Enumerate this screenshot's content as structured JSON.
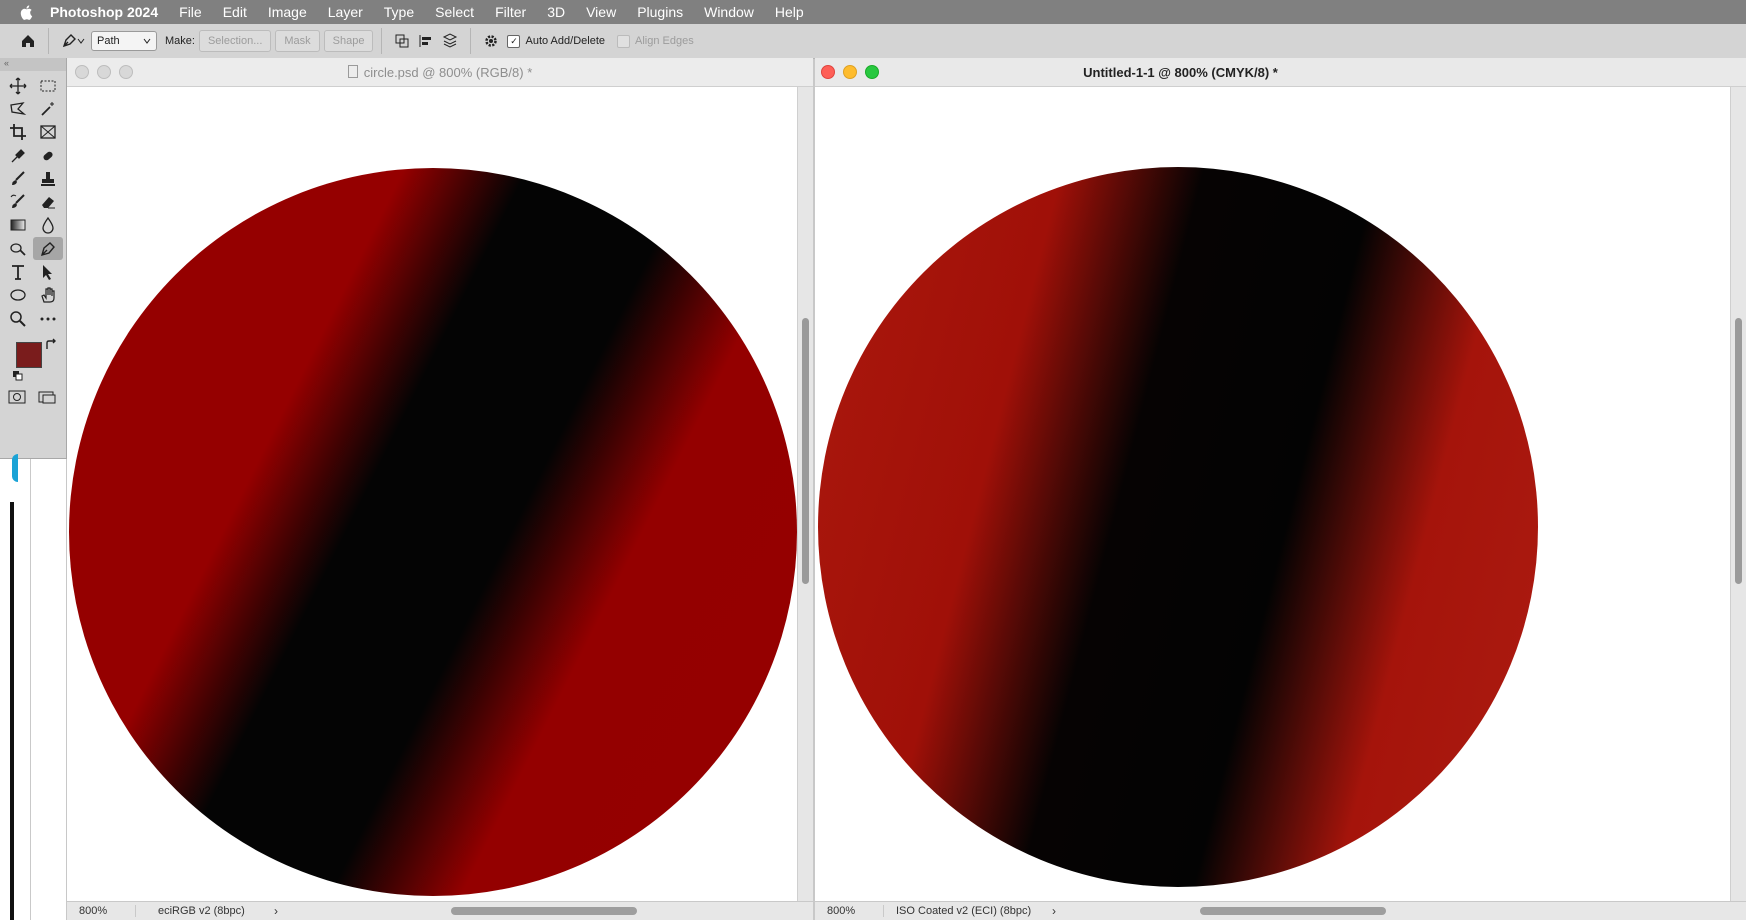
{
  "menubar": {
    "app_name": "Photoshop 2024",
    "items": [
      "File",
      "Edit",
      "Image",
      "Layer",
      "Type",
      "Select",
      "Filter",
      "3D",
      "View",
      "Plugins",
      "Window",
      "Help"
    ]
  },
  "options_bar": {
    "mode_value": "Path",
    "make_label": "Make:",
    "selection_button": "Selection...",
    "mask_button": "Mask",
    "shape_button": "Shape",
    "auto_add_delete": "Auto Add/Delete",
    "auto_add_delete_checked": true,
    "align_edges": "Align Edges",
    "align_edges_checked": false
  },
  "toolbox": {
    "grip": "≡≡≡≡≡",
    "tools": [
      "move-icon",
      "marquee-rect-icon",
      "lasso-polygon-icon",
      "magic-wand-icon",
      "crop-icon",
      "frame-icon",
      "eyedropper-icon",
      "healing-brush-icon",
      "brush-icon",
      "clone-stamp-icon",
      "history-brush-icon",
      "eraser-icon",
      "gradient-icon",
      "blur-icon",
      "dodge-icon",
      "pen-icon",
      "type-icon",
      "path-selection-icon",
      "ellipse-icon",
      "hand-icon",
      "zoom-icon",
      "more-tools-icon"
    ],
    "active_tool": "pen-icon",
    "foreground_color": "#7a1c1c",
    "background_color": "#ffffff"
  },
  "doc_left": {
    "title": "circle.psd @ 800% (RGB/8) *",
    "zoom": "800%",
    "profile": "eciRGB v2 (8bpc)"
  },
  "doc_right": {
    "title": "Untitled-1-1 @ 800% (CMYK/8) *",
    "zoom": "800%",
    "profile": "ISO Coated v2 (ECI) (8bpc)"
  },
  "colors": {
    "red_rgb": "#950000",
    "red_cmyk": "#a8160c",
    "dark": "#030303",
    "traffic_close": "#fe5f57",
    "traffic_min": "#febc2e",
    "traffic_max": "#28c840"
  }
}
